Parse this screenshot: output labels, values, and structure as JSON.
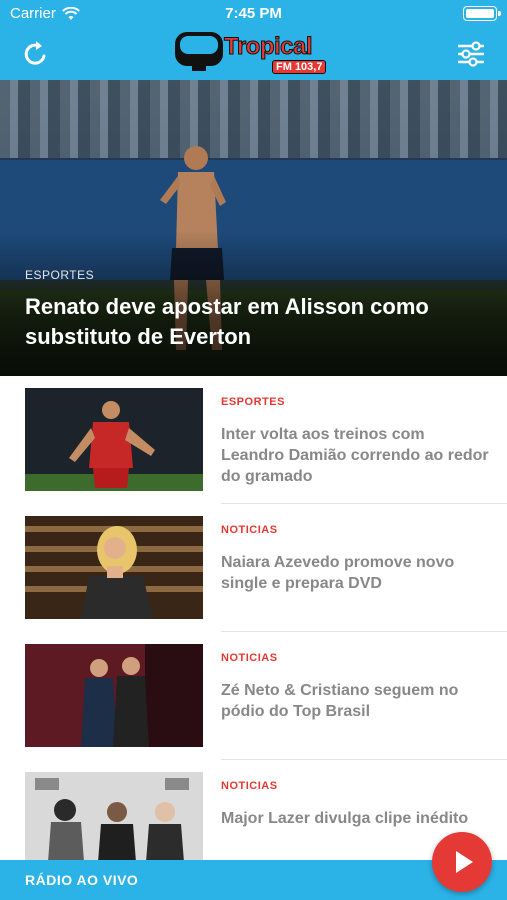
{
  "status_bar": {
    "carrier": "Carrier",
    "time": "7:45 PM"
  },
  "header": {
    "logo_title": "Tropical",
    "logo_frequency": "FM 103,7",
    "refresh_icon": "refresh-icon",
    "settings_icon": "sliders-icon",
    "bar_color": "#2bb3e8"
  },
  "hero": {
    "category": "ESPORTES",
    "title": "Renato deve apostar em Alisson como substituto de Everton"
  },
  "news": [
    {
      "category": "ESPORTES",
      "title": "Inter volta aos treinos com Leandro Damião correndo ao redor do gramado"
    },
    {
      "category": "NOTICIAS",
      "title": "Naiara Azevedo promove novo single e prepara DVD"
    },
    {
      "category": "NOTICIAS",
      "title": "Zé Neto & Cristiano seguem no pódio do Top Brasil"
    },
    {
      "category": "NOTICIAS",
      "title": "Major Lazer divulga clipe inédito"
    }
  ],
  "radio_bar": {
    "label": "RÁDIO AO VIVO",
    "play_icon": "play-icon"
  },
  "colors": {
    "accent": "#e53935",
    "bar": "#2bb3e8",
    "title_gray": "#888888"
  }
}
